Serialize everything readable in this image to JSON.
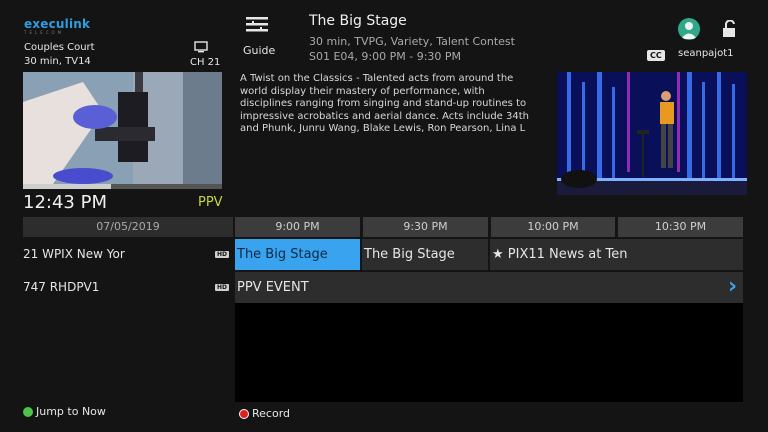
{
  "brand": {
    "name": "execulink",
    "tagline": "TELECOM"
  },
  "current": {
    "title": "Couples Court",
    "meta": "30 min, TV14",
    "channel": "CH 21",
    "clock": "12:43 PM",
    "badge": "PPV",
    "progress": 0.44
  },
  "guide": {
    "label": "Guide",
    "icon": "guide-icon"
  },
  "program": {
    "title": "The Big Stage",
    "meta1": "30 min, TVPG, Variety, Talent Contest",
    "meta2": "S01 E04, 9:00 PM - 9:30 PM",
    "description": "A Twist on the Classics - Talented acts from around the world display their mastery of performance, with disciplines ranging from singing and stand-up routines to impressive acrobatics and aerial dance. Acts include 34th and Phunk, Junru Wang, Blake Lewis, Ron Pearson, Lina L"
  },
  "user": {
    "name": "seanpajot1",
    "cc": "CC"
  },
  "grid": {
    "date": "07/05/2019",
    "times": [
      "9:00 PM",
      "9:30 PM",
      "10:00 PM",
      "10:30 PM"
    ],
    "channels": [
      {
        "name": "21  WPIX New Yor",
        "hd": "HD",
        "programs": [
          "The Big Stage",
          "The Big Stage",
          "★ PIX11 News at Ten"
        ]
      },
      {
        "name": "747  RHDPV1",
        "hd": "HD",
        "programs": [
          "PPV EVENT"
        ]
      }
    ]
  },
  "footer": {
    "jump": "Jump to Now",
    "record": "Record"
  },
  "colors": {
    "selected": "#3aa3ef",
    "ppv": "#c6d63a",
    "green": "#4fc34d",
    "red": "#e02020"
  }
}
